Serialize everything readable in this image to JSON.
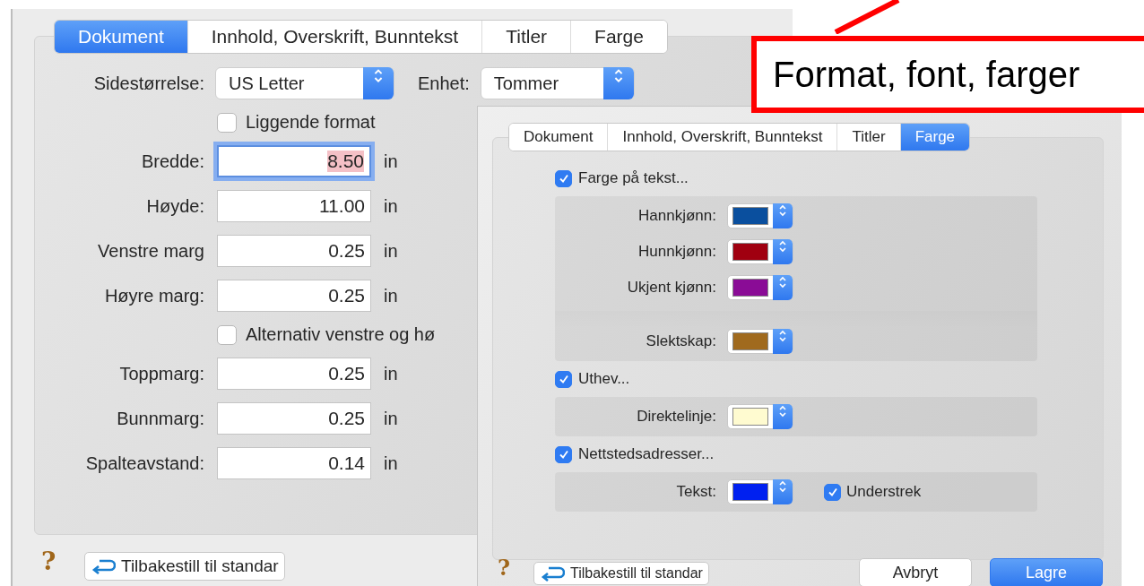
{
  "back_dialog": {
    "tabs": [
      {
        "label": "Dokument",
        "selected": true
      },
      {
        "label": "Innhold, Overskrift, Bunntekst",
        "selected": false
      },
      {
        "label": "Titler",
        "selected": false
      },
      {
        "label": "Farge",
        "selected": false
      }
    ],
    "page_size": {
      "label": "Sidestørrelse:",
      "value": "US Letter"
    },
    "unit": {
      "label": "Enhet:",
      "value": "Tommer"
    },
    "rows": [
      {
        "kind": "checkbox",
        "label": "Liggende format",
        "checked": false
      },
      {
        "kind": "field",
        "label": "Bredde:",
        "value": "8.50",
        "unit": "in",
        "focused": true
      },
      {
        "kind": "field",
        "label": "Høyde:",
        "value": "11.00",
        "unit": "in",
        "focused": false
      },
      {
        "kind": "field",
        "label": "Venstre marg",
        "value": "0.25",
        "unit": "in",
        "focused": false
      },
      {
        "kind": "field",
        "label": "Høyre marg:",
        "value": "0.25",
        "unit": "in",
        "focused": false
      },
      {
        "kind": "checkbox",
        "label": "Alternativ venstre og hø",
        "checked": false
      },
      {
        "kind": "field",
        "label": "Toppmarg:",
        "value": "0.25",
        "unit": "in",
        "focused": false
      },
      {
        "kind": "field",
        "label": "Bunnmarg:",
        "value": "0.25",
        "unit": "in",
        "focused": false
      },
      {
        "kind": "field",
        "label": "Spalteavstand:",
        "value": "0.14",
        "unit": "in",
        "focused": false
      }
    ],
    "help": "?",
    "reset_button": "Tilbakestill til standar"
  },
  "front_dialog": {
    "tabs": [
      {
        "label": "Dokument",
        "selected": false
      },
      {
        "label": "Innhold, Overskrift, Bunntekst",
        "selected": false
      },
      {
        "label": "Titler",
        "selected": false
      },
      {
        "label": "Farge",
        "selected": true
      }
    ],
    "sections": [
      {
        "label": "Farge på tekst...",
        "checked": true,
        "rows": [
          {
            "label": "Hannkjønn:",
            "color": "#0a4f9e",
            "spaced": false
          },
          {
            "label": "Hunnkjønn:",
            "color": "#a00010",
            "spaced": false
          },
          {
            "label": "Ukjent kjønn:",
            "color": "#8a0c96",
            "spaced": false
          },
          {
            "label": "Slektskap:",
            "color": "#a06a1e",
            "spaced": true
          }
        ]
      },
      {
        "label": "Uthev...",
        "checked": true,
        "rows": [
          {
            "label": "Direktelinje:",
            "color": "#fffbd0",
            "spaced": false
          }
        ]
      },
      {
        "label": "Nettstedsadresser...",
        "checked": true,
        "rows": [
          {
            "label": "Tekst:",
            "color": "#0020f0",
            "spaced": false,
            "option": {
              "label": "Understrek",
              "checked": true
            }
          }
        ]
      }
    ],
    "help": "?",
    "reset_button": "Tilbakestill til standar",
    "buttons": [
      {
        "label": "Avbryt",
        "primary": false
      },
      {
        "label": "Lagre",
        "primary": true
      }
    ]
  },
  "callout": {
    "text": "Format, font, farger"
  }
}
